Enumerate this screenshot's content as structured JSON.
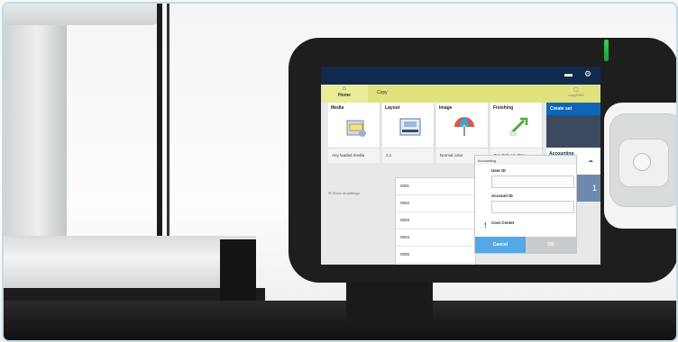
{
  "app": {
    "top_bar_icons": [
      "window-icon",
      "gear-icon"
    ],
    "tabs": {
      "home": "Home",
      "copy": "Copy",
      "dsm": "copyDSM"
    }
  },
  "tiles": [
    {
      "title": "Media",
      "value": "Any loaded media",
      "icon": "media-icon"
    },
    {
      "title": "Layout",
      "value": "1:1",
      "icon": "layout-icon"
    },
    {
      "title": "Image",
      "value": "Normal color",
      "icon": "umbrella-icon"
    },
    {
      "title": "Finishing",
      "value": "Top Delivery Tray",
      "icon": "finishing-icon"
    }
  ],
  "right_column": {
    "create_set": "Create set",
    "accounting_label": "Accounting",
    "accounting_status": "...ded",
    "number": "1"
  },
  "show_all": "Show all settings",
  "list": [
    "0001",
    "0002",
    "0003",
    "0004",
    "0005"
  ],
  "dialog": {
    "title": "Accounting",
    "user_id_label": "User ID",
    "account_id_label": "Account ID",
    "cost_center_label": "Cost Center",
    "cancel": "Cancel",
    "ok": "OK"
  },
  "colors": {
    "topbar": "#10294d",
    "tabbar": "#dfe27f",
    "accent": "#0f66b8",
    "cancel": "#56a7e6",
    "led": "#3cd05a"
  }
}
